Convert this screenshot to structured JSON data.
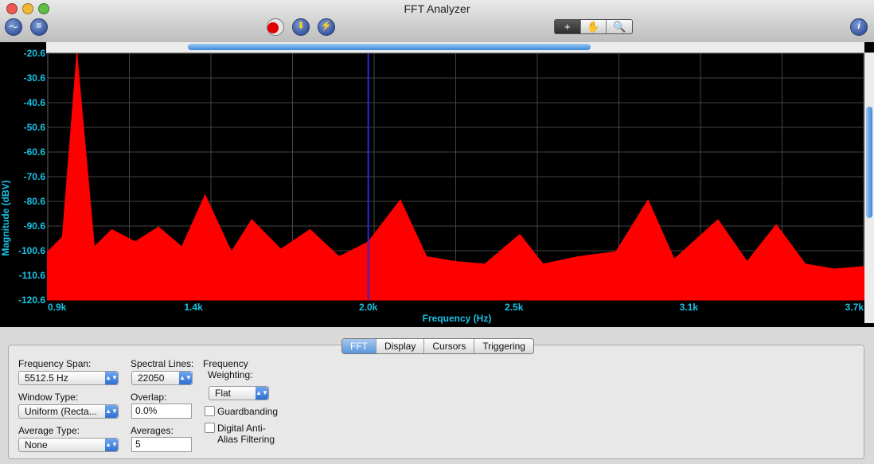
{
  "window": {
    "title": "FFT Analyzer"
  },
  "toolbar": {
    "left_icons": [
      "waveform-icon",
      "settings-icon"
    ],
    "center_icons": [
      "record-icon",
      "download-icon",
      "lightning-icon"
    ],
    "mode": [
      "+",
      "✋",
      "🔍"
    ],
    "info_label": "i"
  },
  "chart_data": {
    "type": "line",
    "xlabel": "Frequency (Hz)",
    "ylabel": "Magnitude (dBV)",
    "x_ticks": [
      {
        "value": 0.9,
        "label": "0.9k"
      },
      {
        "value": 1.4,
        "label": "1.4k"
      },
      {
        "value": 2.0,
        "label": "2.0k"
      },
      {
        "value": 2.5,
        "label": "2.5k"
      },
      {
        "value": 3.1,
        "label": "3.1k"
      },
      {
        "value": 3.7,
        "label": "3.7k"
      }
    ],
    "y_ticks": [
      -20.6,
      -30.6,
      -40.6,
      -50.6,
      -60.6,
      -70.6,
      -80.6,
      -90.6,
      -100.6,
      -110.6,
      -120.6
    ],
    "xlim": [
      0.9,
      3.7
    ],
    "ylim": [
      -120.6,
      -20.6
    ],
    "series": [
      {
        "color": "#ff0000",
        "points": [
          {
            "x": 0.9,
            "y": -101
          },
          {
            "x": 0.95,
            "y": -95
          },
          {
            "x": 1.0,
            "y": -20.6
          },
          {
            "x": 1.06,
            "y": -99
          },
          {
            "x": 1.12,
            "y": -92
          },
          {
            "x": 1.2,
            "y": -97
          },
          {
            "x": 1.28,
            "y": -91
          },
          {
            "x": 1.36,
            "y": -99
          },
          {
            "x": 1.44,
            "y": -78
          },
          {
            "x": 1.53,
            "y": -101
          },
          {
            "x": 1.6,
            "y": -88
          },
          {
            "x": 1.7,
            "y": -100
          },
          {
            "x": 1.8,
            "y": -92
          },
          {
            "x": 1.9,
            "y": -103
          },
          {
            "x": 2.0,
            "y": -97
          },
          {
            "x": 2.11,
            "y": -80
          },
          {
            "x": 2.2,
            "y": -103
          },
          {
            "x": 2.3,
            "y": -105
          },
          {
            "x": 2.4,
            "y": -106
          },
          {
            "x": 2.52,
            "y": -94
          },
          {
            "x": 2.6,
            "y": -106
          },
          {
            "x": 2.72,
            "y": -103
          },
          {
            "x": 2.85,
            "y": -101
          },
          {
            "x": 2.96,
            "y": -80
          },
          {
            "x": 3.05,
            "y": -104
          },
          {
            "x": 3.2,
            "y": -88
          },
          {
            "x": 3.3,
            "y": -105
          },
          {
            "x": 3.4,
            "y": -90
          },
          {
            "x": 3.5,
            "y": -106
          },
          {
            "x": 3.6,
            "y": -108
          },
          {
            "x": 3.7,
            "y": -107
          }
        ]
      }
    ],
    "cursor_x": 2.0,
    "grid": true,
    "background": "#000000",
    "axis_label_color": "#19c3e6",
    "grid_color": "#444444"
  },
  "tabs": [
    "FFT",
    "Display",
    "Cursors",
    "Triggering"
  ],
  "controls": {
    "frequency_span": {
      "label": "Frequency Span:",
      "value": "5512.5 Hz"
    },
    "spectral_lines": {
      "label": "Spectral Lines:",
      "value": "22050"
    },
    "frequency_weighting": {
      "label_line1": "Frequency",
      "label_line2": "Weighting:",
      "value": "Flat"
    },
    "window_type": {
      "label": "Window Type:",
      "value": "Uniform (Recta..."
    },
    "overlap": {
      "label": "Overlap:",
      "value": "0.0%"
    },
    "average_type": {
      "label": "Average Type:",
      "value": "None"
    },
    "averages": {
      "label": "Averages:",
      "value": "5"
    },
    "guardbanding": {
      "label": "Guardbanding",
      "checked": false
    },
    "digital_anti_alias": {
      "label_line1": "Digital Anti-",
      "label_line2": "Alias Filtering",
      "checked": false
    }
  }
}
